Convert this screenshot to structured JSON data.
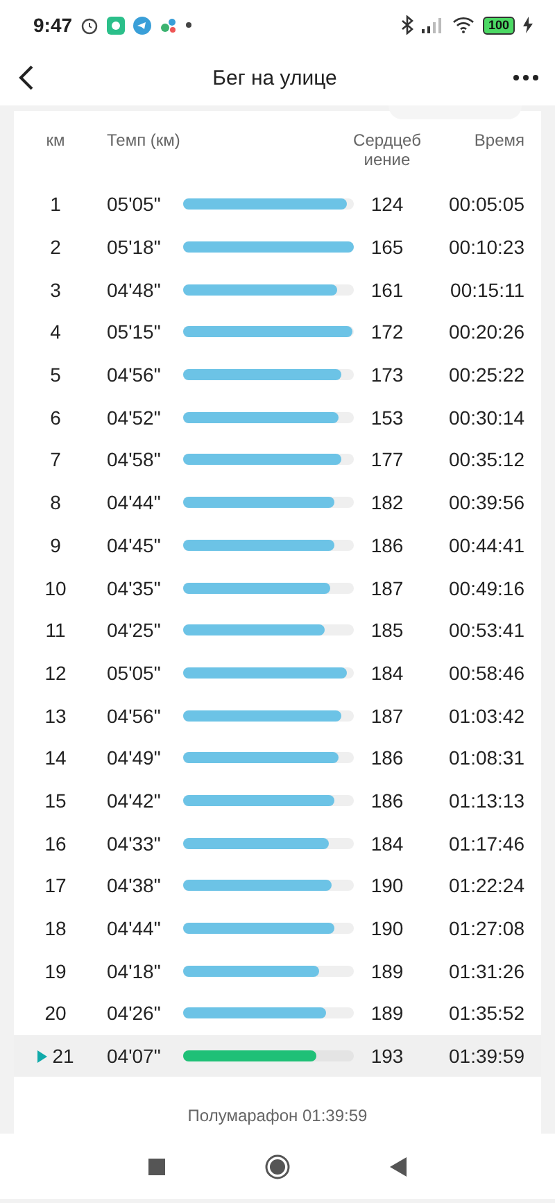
{
  "status_bar": {
    "time": "9:47",
    "battery": "100"
  },
  "app_bar": {
    "title": "Бег на улице"
  },
  "table": {
    "columns": [
      "км",
      "Темп (км)",
      "Сердцеб иение",
      "Время"
    ],
    "rows": [
      {
        "km": "1",
        "pace": "05'05\"",
        "level": 0.96,
        "heart": "124",
        "time": "00:05:05",
        "selected": false
      },
      {
        "km": "2",
        "pace": "05'18\"",
        "level": 1.0,
        "heart": "165",
        "time": "00:10:23",
        "selected": false
      },
      {
        "km": "3",
        "pace": "04'48\"",
        "level": 0.9,
        "heart": "161",
        "time": "00:15:11",
        "selected": false
      },
      {
        "km": "4",
        "pace": "05'15\"",
        "level": 0.99,
        "heart": "172",
        "time": "00:20:26",
        "selected": false
      },
      {
        "km": "5",
        "pace": "04'56\"",
        "level": 0.93,
        "heart": "173",
        "time": "00:25:22",
        "selected": false
      },
      {
        "km": "6",
        "pace": "04'52\"",
        "level": 0.91,
        "heart": "153",
        "time": "00:30:14",
        "selected": false
      },
      {
        "km": "7",
        "pace": "04'58\"",
        "level": 0.93,
        "heart": "177",
        "time": "00:35:12",
        "selected": false
      },
      {
        "km": "8",
        "pace": "04'44\"",
        "level": 0.89,
        "heart": "182",
        "time": "00:39:56",
        "selected": false
      },
      {
        "km": "9",
        "pace": "04'45\"",
        "level": 0.89,
        "heart": "186",
        "time": "00:44:41",
        "selected": false
      },
      {
        "km": "10",
        "pace": "04'35\"",
        "level": 0.86,
        "heart": "187",
        "time": "00:49:16",
        "selected": false
      },
      {
        "km": "11",
        "pace": "04'25\"",
        "level": 0.83,
        "heart": "185",
        "time": "00:53:41",
        "selected": false
      },
      {
        "km": "12",
        "pace": "05'05\"",
        "level": 0.96,
        "heart": "184",
        "time": "00:58:46",
        "selected": false
      },
      {
        "km": "13",
        "pace": "04'56\"",
        "level": 0.93,
        "heart": "187",
        "time": "01:03:42",
        "selected": false
      },
      {
        "km": "14",
        "pace": "04'49\"",
        "level": 0.91,
        "heart": "186",
        "time": "01:08:31",
        "selected": false
      },
      {
        "km": "15",
        "pace": "04'42\"",
        "level": 0.89,
        "heart": "186",
        "time": "01:13:13",
        "selected": false
      },
      {
        "km": "16",
        "pace": "04'33\"",
        "level": 0.85,
        "heart": "184",
        "time": "01:17:46",
        "selected": false
      },
      {
        "km": "17",
        "pace": "04'38\"",
        "level": 0.87,
        "heart": "190",
        "time": "01:22:24",
        "selected": false
      },
      {
        "km": "18",
        "pace": "04'44\"",
        "level": 0.89,
        "heart": "190",
        "time": "01:27:08",
        "selected": false
      },
      {
        "km": "19",
        "pace": "04'18\"",
        "level": 0.8,
        "heart": "189",
        "time": "01:31:26",
        "selected": false
      },
      {
        "km": "20",
        "pace": "04'26\"",
        "level": 0.84,
        "heart": "189",
        "time": "01:35:52",
        "selected": false
      },
      {
        "km": "21",
        "pace": "04'07\"",
        "level": 0.78,
        "heart": "193",
        "time": "01:39:59",
        "selected": true
      }
    ]
  },
  "footer": "Полумарафон 01:39:59"
}
